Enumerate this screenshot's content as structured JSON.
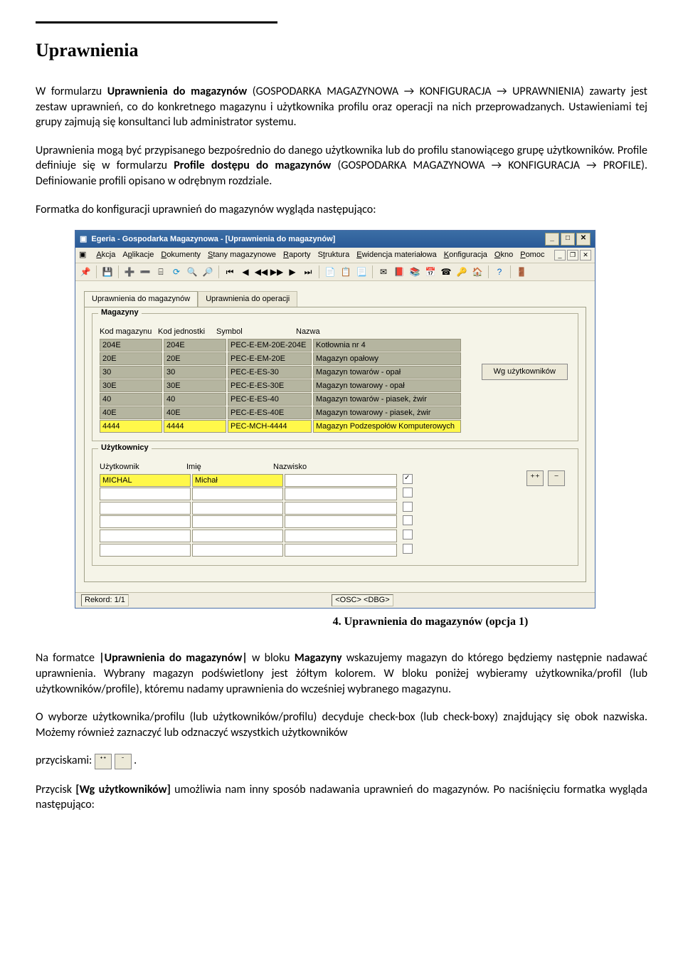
{
  "doc": {
    "heading": "Uprawnienia",
    "p1_a": "W formularzu ",
    "p1_b": "Uprawnienia do magazynów",
    "p1_c": " (GOSPODARKA MAGAZYNOWA → KONFIGURACJA → UPRAWNIENIA) zawarty jest zestaw uprawnień, co do konkretnego magazynu i użytkownika profilu oraz operacji na nich przeprowadzanych. Ustawieniami tej grupy zajmują się konsultanci lub administrator systemu.",
    "p2_a": "Uprawnienia mogą być przypisanego bezpośrednio do danego użytkownika  lub do profilu stanowiącego grupę użytkowników. Profile definiuje się w formularzu ",
    "p2_b": "Profile dostępu do magazynów",
    "p2_c": " (GOSPODARKA MAGAZYNOWA → KONFIGURACJA → PROFILE). Definiowanie profili opisano w odrębnym rozdziale.",
    "p3": "Formatka do konfiguracji uprawnień do magazynów wygląda następująco:",
    "caption": "4.   Uprawnienia do magazynów (opcja 1)",
    "p4_a": "Na formatce ",
    "p4_b": "|Uprawnienia do magazynów|",
    "p4_c": " w bloku ",
    "p4_d": "Magazyny",
    "p4_e": " wskazujemy magazyn do którego będziemy następnie nadawać uprawnienia. Wybrany magazyn podświetlony jest żółtym kolorem. W bloku poniżej wybieramy użytkownika/profil (lub użytkowników/profile), któremu nadamy uprawnienia do wcześniej wybranego magazynu.",
    "p5": "O wyborze użytkownika/profilu (lub użytkowników/profilu) decyduje check-box (lub check-boxy) znajdujący się obok nazwiska. Możemy również zaznaczyć lub odznaczyć wszystkich użytkowników",
    "p6_a": "przyciskami: ",
    "p6_b": ".",
    "p7_a": "Przycisk ",
    "p7_b": "[Wg użytkowników]",
    "p7_c": " umożliwia nam inny sposób nadawania uprawnień do magazynów. Po naciśnięciu formatka wygląda następująco:"
  },
  "app": {
    "title": "Egeria - Gospodarka Magazynowa - [Uprawnienia do magazynów]",
    "menus": [
      "Akcja",
      "Aplikacje",
      "Dokumenty",
      "Stany magazynowe",
      "Raporty",
      "Struktura",
      "Ewidencja materiałowa",
      "Konfiguracja",
      "Okno",
      "Pomoc"
    ],
    "tabs": [
      "Uprawnienia do magazynów",
      "Uprawnienia do operacji"
    ],
    "side_button": "Wg użytkowników",
    "magazyny": {
      "title": "Magazyny",
      "headers": [
        "Kod magazynu",
        "Kod jednostki",
        "Symbol",
        "Nazwa"
      ],
      "widths": [
        80,
        80,
        110,
        200
      ],
      "rows": [
        [
          "204E",
          "204E",
          "PEC-E-EM-20E-204E",
          "Kotłownia nr 4"
        ],
        [
          "20E",
          "20E",
          "PEC-E-EM-20E",
          "Magazyn opałowy"
        ],
        [
          "30",
          "30",
          "PEC-E-ES-30",
          "Magazyn towarów - opał"
        ],
        [
          "30E",
          "30E",
          "PEC-E-ES-30E",
          "Magazyn towarowy - opał"
        ],
        [
          "40",
          "40",
          "PEC-E-ES-40",
          "Magazyn towarów - piasek, żwir"
        ],
        [
          "40E",
          "40E",
          "PEC-E-ES-40E",
          "Magazyn towarowy - piasek, żwir"
        ],
        [
          "4444",
          "4444",
          "PEC-MCH-4444",
          "Magazyn Podzespołów Komputerowych"
        ]
      ],
      "selected": 6
    },
    "uzytkownicy": {
      "title": "Użytkownicy",
      "headers": [
        "Użytkownik",
        "Imię",
        "Nazwisko"
      ],
      "widths": [
        120,
        120,
        150
      ],
      "rows": [
        [
          "MICHAL",
          "Michał",
          ""
        ],
        [
          "",
          "",
          ""
        ],
        [
          "",
          "",
          ""
        ],
        [
          "",
          "",
          ""
        ],
        [
          "",
          "",
          ""
        ],
        [
          "",
          "",
          ""
        ]
      ],
      "selected": 0,
      "checked": [
        true,
        false,
        false,
        false,
        false,
        false
      ]
    },
    "status": {
      "record": "Rekord: 1/1",
      "mode": "<OSC> <DBG>"
    }
  }
}
